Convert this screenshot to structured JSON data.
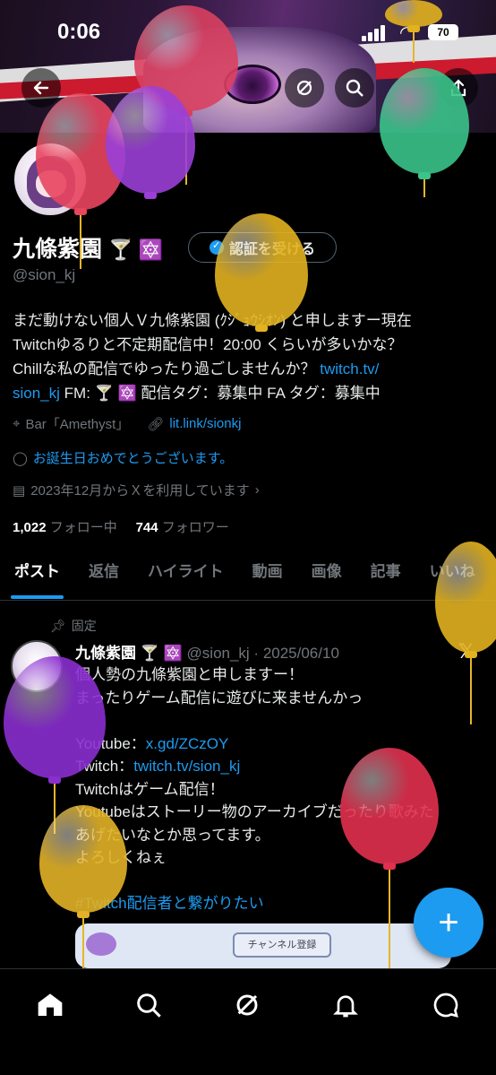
{
  "status_bar": {
    "time": "0:06",
    "battery": "70"
  },
  "profile": {
    "name": "九條紫園",
    "name_emojis": "🍸 🔯",
    "handle": "@sion_kj",
    "verify_button": "認証を受ける",
    "bio_lines": [
      "まだ動けない個人Ｖ九條紫園 (ｸｼﾞｮｳｼｵﾝ) と申しますー現在",
      "Twitchゆるりと不定期配信中！20:00 くらいが多いかな？",
      "Chillな私の配信でゆったり過ごしませんか？ "
    ],
    "bio_link": "twitch.tv/sion_kj",
    "bio_link_part1": "twitch.tv/",
    "bio_link_part2": "sion_kj",
    "bio_tail": " FM: 🍸 🔯 配信タグ：募集中 FA タグ：募集中",
    "location": "Bar「Amethyst」",
    "website": "lit.link/sionkj",
    "birthday": "お誕生日おめでとうございます。",
    "joined": "2023年12月からＸを利用しています",
    "following_count": "1,022",
    "following_label": "フォロー中",
    "followers_count": "744",
    "followers_label": "フォロワー"
  },
  "tabs": [
    "ポスト",
    "返信",
    "ハイライト",
    "動画",
    "画像",
    "記事",
    "いいね"
  ],
  "pinned_post": {
    "pinned_label": "固定",
    "author": "九條紫園",
    "author_emojis": "🍸 🔯",
    "handle_date": "@sion_kj · 2025/06/10",
    "lines": [
      "個人勢の九條紫園と申しますー！",
      "まったりゲーム配信に遊びに来ませんかっ",
      "",
      "Youtube：",
      "Twitch：",
      "Twitchはゲーム配信！",
      "Youtubeはストーリー物のアーカイブだったり歌みた",
      "あげたいなとか思ってます。",
      "よろしくねぇ",
      "",
      "#Twitch配信者と繋がりたい"
    ],
    "youtube_link": "x.gd/ZCzOY",
    "twitch_link": "twitch.tv/sion_kj",
    "media_button": "チャンネル登録"
  },
  "colors": {
    "accent": "#1d9bf0",
    "background": "#000000",
    "muted": "#71767b"
  },
  "icons": {
    "back": "back-arrow-icon",
    "grok": "grok-icon",
    "search": "search-icon",
    "share": "share-icon",
    "home": "home-icon",
    "nav_search": "search-icon",
    "grok_nav": "grok-icon",
    "notifications": "bell-icon",
    "messages": "message-icon",
    "compose": "plus-icon"
  }
}
